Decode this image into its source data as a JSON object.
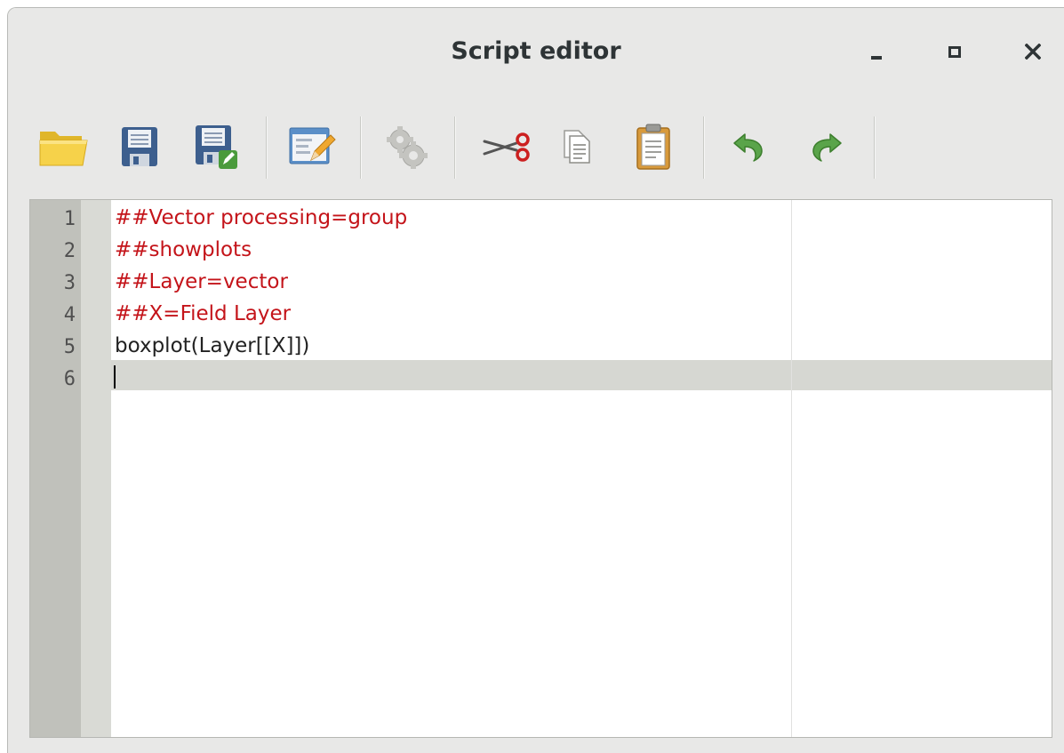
{
  "window": {
    "title": "Script editor"
  },
  "toolbar": {
    "buttons": [
      {
        "name": "open-script-button",
        "icon": "folder-open-icon"
      },
      {
        "name": "save-script-button",
        "icon": "floppy-disk-icon"
      },
      {
        "name": "save-as-button",
        "icon": "floppy-disk-edit-icon"
      },
      {
        "name": "edit-help-button",
        "icon": "form-edit-icon"
      },
      {
        "name": "run-algorithm-button",
        "icon": "gears-icon"
      },
      {
        "name": "cut-button",
        "icon": "scissors-icon"
      },
      {
        "name": "copy-button",
        "icon": "copy-icon"
      },
      {
        "name": "paste-button",
        "icon": "clipboard-icon"
      },
      {
        "name": "undo-button",
        "icon": "undo-arrow-icon"
      },
      {
        "name": "redo-button",
        "icon": "redo-arrow-icon"
      }
    ]
  },
  "colors": {
    "comment": "#c4141a",
    "code": "#222222",
    "folder": "#f5d142",
    "disk": "#3d5f8e",
    "arrow": "#5aa44a"
  },
  "editor": {
    "lines": [
      {
        "number": "1",
        "text": "##Vector processing=group",
        "kind": "comment"
      },
      {
        "number": "2",
        "text": "##showplots",
        "kind": "comment"
      },
      {
        "number": "3",
        "text": "##Layer=vector",
        "kind": "comment"
      },
      {
        "number": "4",
        "text": "##X=Field Layer",
        "kind": "comment"
      },
      {
        "number": "5",
        "text": "boxplot(Layer[[X]])",
        "kind": "plain"
      },
      {
        "number": "6",
        "text": "",
        "kind": "plain"
      }
    ],
    "current_line": "6"
  }
}
